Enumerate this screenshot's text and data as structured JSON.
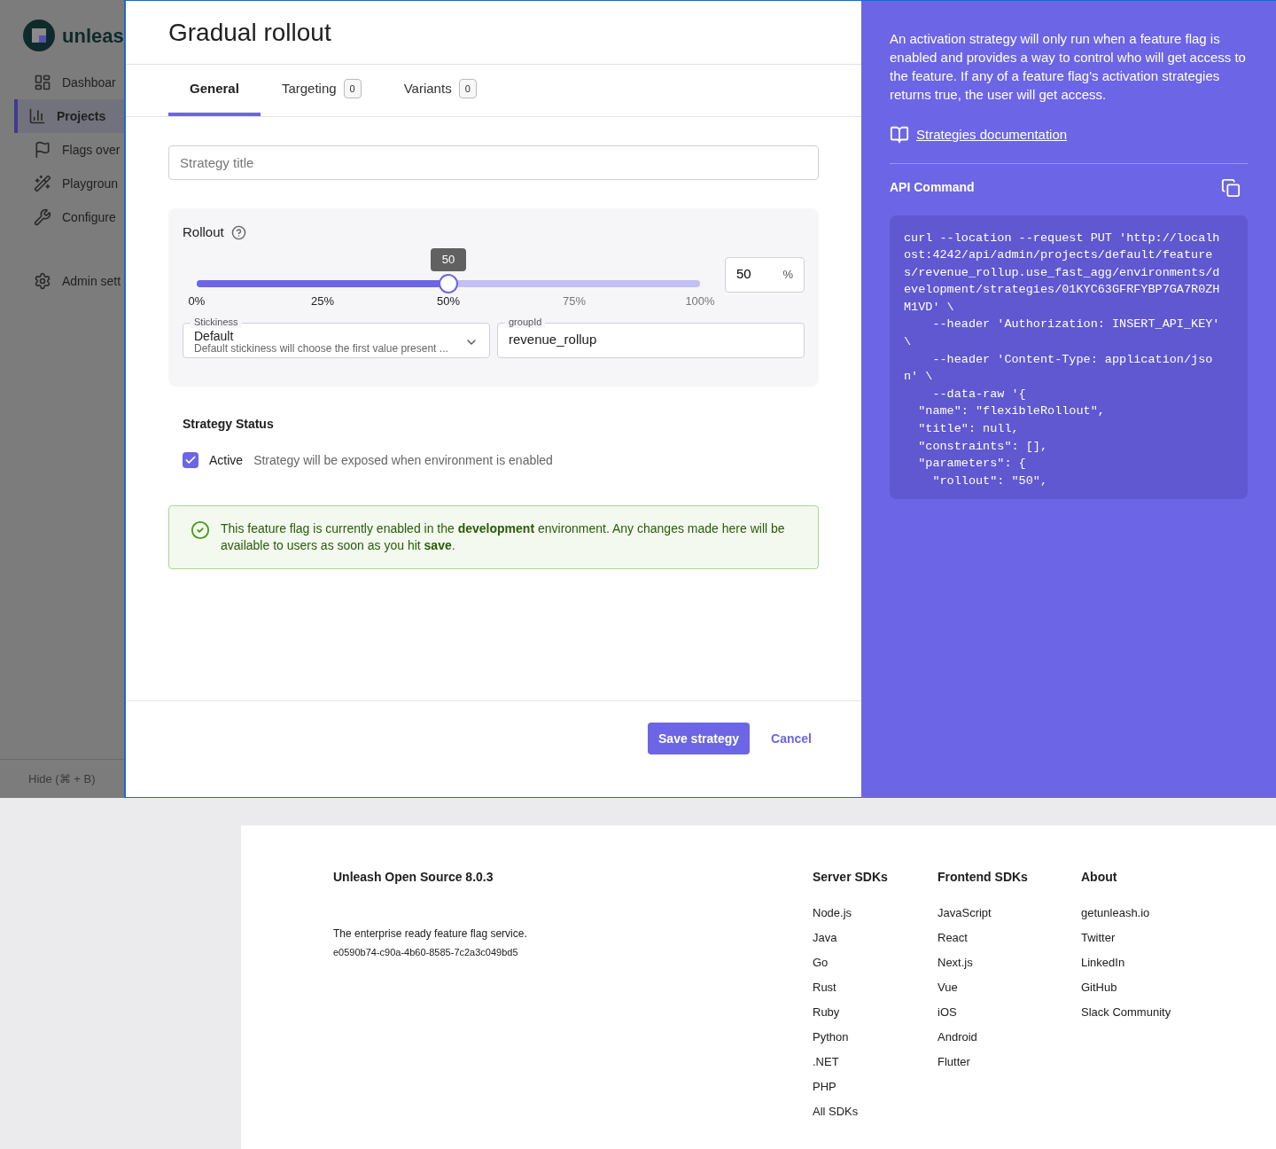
{
  "sidebar": {
    "logo_text": "unleas",
    "items": [
      {
        "label": "Dashboar",
        "selected": false
      },
      {
        "label": "Projects",
        "selected": true
      },
      {
        "label": "Flags over",
        "selected": false
      },
      {
        "label": "Playgroun",
        "selected": false
      },
      {
        "label": "Configure",
        "selected": false
      },
      {
        "label": "Admin sett",
        "selected": false
      }
    ],
    "hide_label": "Hide (⌘ + B)"
  },
  "modal": {
    "title": "Gradual rollout",
    "tabs": [
      {
        "label": "General",
        "selected": true
      },
      {
        "label": "Targeting",
        "count": "0",
        "selected": false
      },
      {
        "label": "Variants",
        "count": "0",
        "selected": false
      }
    ],
    "strategy_title": {
      "placeholder": "Strategy title"
    },
    "rollout": {
      "label": "Rollout",
      "level": 0.5,
      "tooltip": "50",
      "marks": [
        "0%",
        "25%",
        "50%",
        "75%",
        "100%"
      ],
      "value": "50",
      "unit": "%",
      "stickiness": {
        "label": "Stickiness",
        "value": "Default",
        "hint": "Default stickiness will choose the first value present ..."
      },
      "group_id": {
        "label": "groupId",
        "value": "revenue_rollup"
      }
    },
    "status": {
      "heading": "Strategy Status",
      "checked": true,
      "label": "Active",
      "description": "Strategy will be exposed when environment is enabled"
    },
    "alert": "This feature flag is currently enabled in the **development** environment. Any changes made here will be available to users as soon as you hit **save**.",
    "buttons": {
      "save": "Save strategy",
      "cancel": "Cancel"
    }
  },
  "help": {
    "text": "An activation strategy will only run when a feature flag is enabled and provides a way to control who will get access to the feature. If any of a feature flag's activation strategies returns true, the user will get access.",
    "doc_link": "Strategies documentation",
    "api_heading": "API Command",
    "code_lines": [
      "curl --location --request PUT 'http://localh",
      "ost:4242/api/admin/projects/default/feature",
      "s/revenue_rollup.use_fast_agg/environments/d",
      "evelopment/strategies/01KYC63GFRFYBP7GA7R0ZH",
      "M1VD' \\",
      "    --header 'Authorization: INSERT_API_KEY'",
      "\\",
      "    --header 'Content-Type: application/jso",
      "n' \\",
      "    --data-raw '{",
      "  \"name\": \"flexibleRollout\",",
      "  \"title\": null,",
      "  \"constraints\": [],",
      "  \"parameters\": {",
      "    \"rollout\": \"50\","
    ]
  },
  "footer": {
    "title": "Unleash Open Source 8.0.3",
    "tagline": "The enterprise ready feature flag service.",
    "build": "e0590b74-c90a-4b60-8585-7c2a3c049bd5",
    "columns": [
      {
        "heading": "Server SDKs",
        "links": [
          "Node.js",
          "Java",
          "Go",
          "Rust",
          "Ruby",
          "Python",
          ".NET",
          "PHP",
          "All SDKs"
        ]
      },
      {
        "heading": "Frontend SDKs",
        "links": [
          "JavaScript",
          "React",
          "Next.js",
          "Vue",
          "iOS",
          "Android",
          "Flutter"
        ]
      },
      {
        "heading": "About",
        "links": [
          "getunleash.io",
          "Twitter",
          "LinkedIn",
          "GitHub",
          "Slack Community"
        ]
      }
    ]
  }
}
